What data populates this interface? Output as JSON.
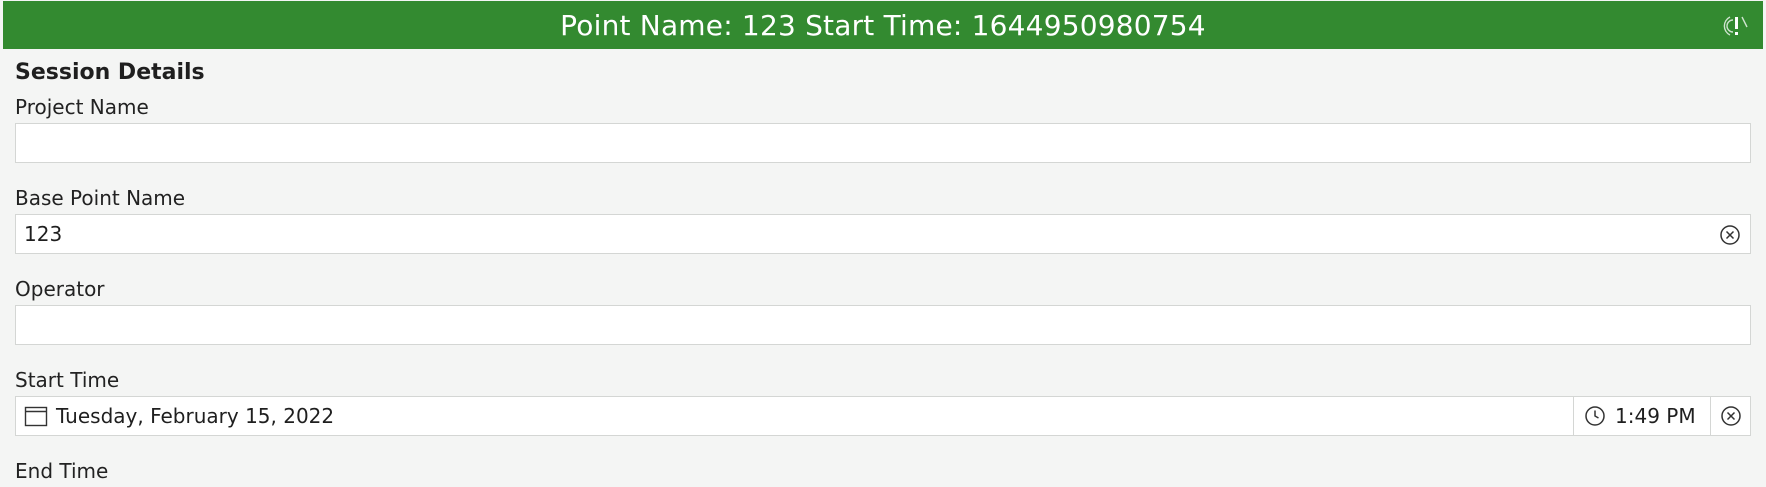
{
  "header": {
    "title": "Point Name: 123 Start Time: 1644950980754",
    "background_color": "#338a30",
    "status_icon": "gps-warning-icon"
  },
  "form": {
    "section_title": "Session Details",
    "project_name": {
      "label": "Project Name",
      "value": ""
    },
    "base_point_name": {
      "label": "Base Point Name",
      "value": "123"
    },
    "operator": {
      "label": "Operator",
      "value": ""
    },
    "start_time": {
      "label": "Start Time",
      "date": "Tuesday, February 15, 2022",
      "time": "1:49 PM"
    },
    "end_time": {
      "label": "End Time"
    }
  }
}
